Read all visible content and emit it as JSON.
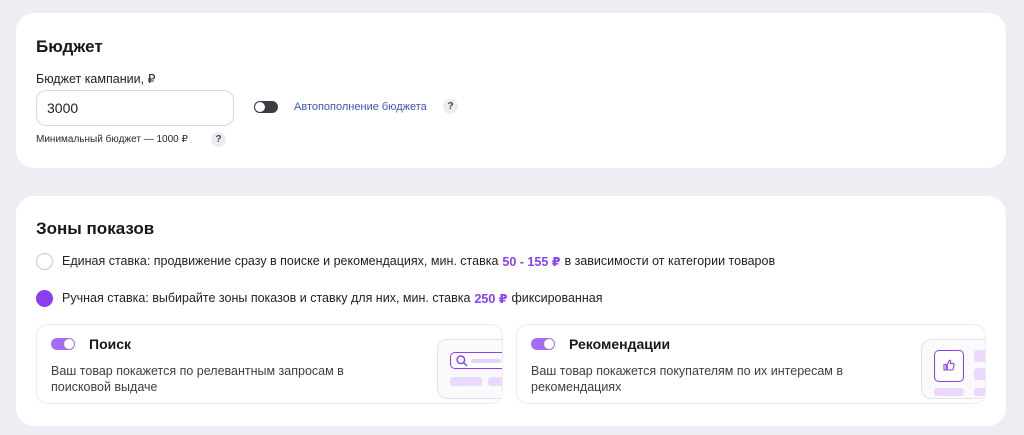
{
  "budget": {
    "title": "Бюджет",
    "field_label": "Бюджет кампании, ₽",
    "input_value": "3000",
    "autofill_enabled": false,
    "autofill_label": "Автопополнение бюджета",
    "help_mark": "?",
    "min_budget_note": "Минимальный бюджет — 1000 ₽"
  },
  "zones": {
    "title": "Зоны показов",
    "options": [
      {
        "checked": false,
        "text_before": "Единая ставка: продвижение сразу в поиске и рекомендациях, мин. ставка",
        "accent": "50 - 155 ₽",
        "text_after": "в зависимости от категории товаров"
      },
      {
        "checked": true,
        "text_before": "Ручная ставка: выбирайте зоны показов и ставку для них, мин. ставка",
        "accent": "250 ₽",
        "text_after": "фиксированная"
      }
    ],
    "cards": [
      {
        "enabled": true,
        "title": "Поиск",
        "description": "Ваш товар покажется по релевантным запросам в поисковой выдаче",
        "icon": "search-magnifier-icon"
      },
      {
        "enabled": true,
        "title": "Рекомендации",
        "description": "Ваш товар покажется покупателям по их интересам в рекомендациях",
        "icon": "thumbs-up-icon"
      }
    ]
  },
  "colors": {
    "accent": "#8a3ff0",
    "link": "#3c57b8",
    "page_background": "#edeef3"
  }
}
